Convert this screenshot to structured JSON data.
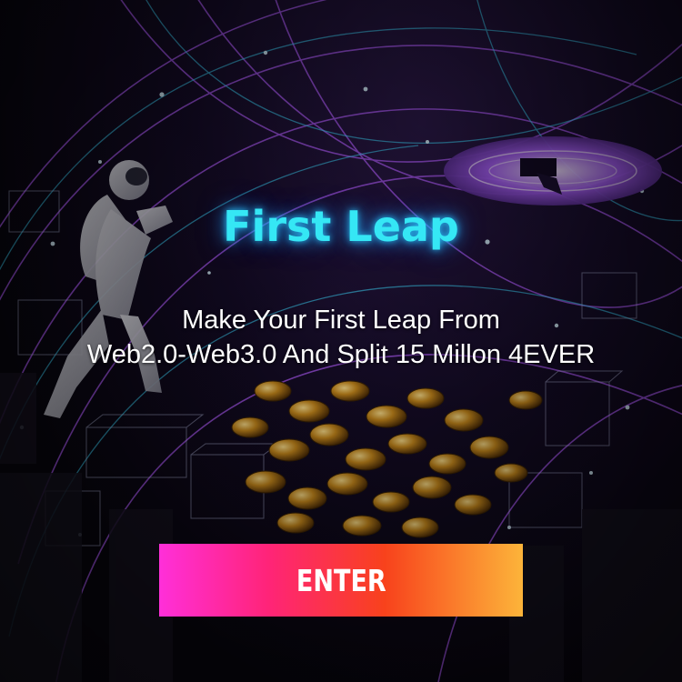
{
  "hero": {
    "title": "First Leap",
    "subtitle_line1": "Make Your First Leap From",
    "subtitle_line2": "Web2.0-Web3.0 And Split 15 Millon 4EVER",
    "title_color": "#35e7f5"
  },
  "cta": {
    "label": "ENTER",
    "gradient_colors": [
      "#ff2fd9",
      "#ff2478",
      "#f8421c",
      "#fcb43a"
    ]
  },
  "background": {
    "imagery": [
      "astronaut-figure",
      "glowing-arc-lines",
      "gold-coins",
      "wireframe-cubes",
      "flying-saucer"
    ],
    "accent_colors": [
      "#b75cff",
      "#39d6ff",
      "#d4a23a"
    ]
  }
}
